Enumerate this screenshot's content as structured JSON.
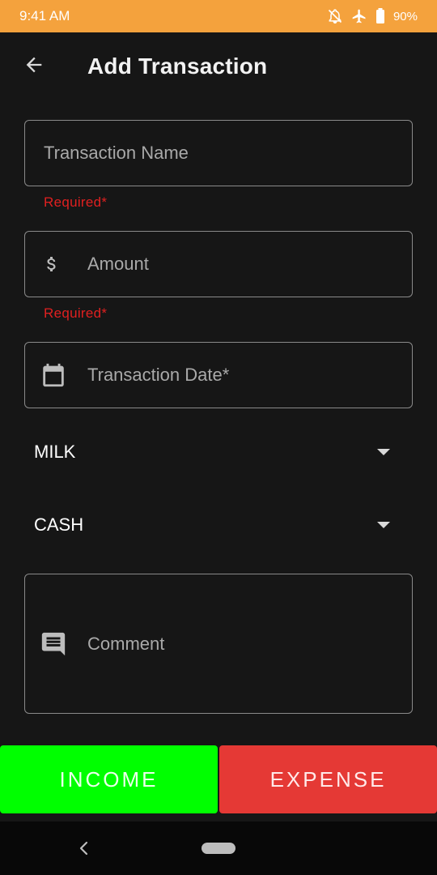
{
  "status_bar": {
    "time": "9:41 AM",
    "battery": "90%"
  },
  "app_bar": {
    "title": "Add Transaction"
  },
  "form": {
    "name_placeholder": "Transaction Name",
    "name_error": "Required*",
    "amount_placeholder": "Amount",
    "amount_error": "Required*",
    "date_placeholder": "Transaction Date*",
    "category_value": "MILK",
    "payment_value": "CASH",
    "comment_placeholder": "Comment"
  },
  "actions": {
    "income_label": "INCOME",
    "expense_label": "EXPENSE"
  },
  "colors": {
    "status_bar": "#f4a23d",
    "income": "#00ff00",
    "expense": "#e53935",
    "error": "#e02020",
    "background": "#161616"
  },
  "icons": [
    "bell-off-icon",
    "airplane-icon",
    "battery-icon",
    "back-arrow-icon",
    "dollar-icon",
    "calendar-icon",
    "comment-icon",
    "chevron-down-icon",
    "nav-back-icon"
  ]
}
